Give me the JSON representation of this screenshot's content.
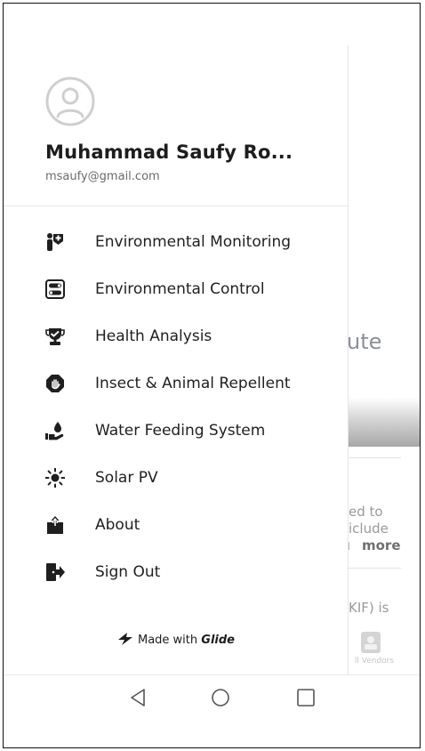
{
  "background_page": {
    "title_fragment": "ute",
    "text_lines": [
      "ed to",
      "iclude"
    ],
    "more_label": "more",
    "text_fragment_2": "KIF) is",
    "tab_label": "ll Vendors"
  },
  "drawer": {
    "user": {
      "name": "Muhammad Saufy Ro...",
      "email": "msaufy@gmail.com",
      "avatar_icon": "user-circle-icon"
    },
    "menu": [
      {
        "label": "Environmental Monitoring",
        "icon": "monitoring-icon"
      },
      {
        "label": "Environmental Control",
        "icon": "control-toggle-icon"
      },
      {
        "label": "Health Analysis",
        "icon": "health-trophy-icon"
      },
      {
        "label": "Insect & Animal Repellent",
        "icon": "stop-hand-icon"
      },
      {
        "label": "Water Feeding System",
        "icon": "water-drop-hand-icon"
      },
      {
        "label": "Solar PV",
        "icon": "sun-icon"
      },
      {
        "label": "About",
        "icon": "share-upload-icon"
      },
      {
        "label": "Sign Out",
        "icon": "sign-out-door-icon"
      }
    ],
    "footer": {
      "prefix": "Made with",
      "brand": "Glide",
      "icon": "glide-logo-icon"
    }
  },
  "system_nav": {
    "back_icon": "back-triangle-icon",
    "home_icon": "home-circle-icon",
    "recents_icon": "recents-square-icon"
  }
}
